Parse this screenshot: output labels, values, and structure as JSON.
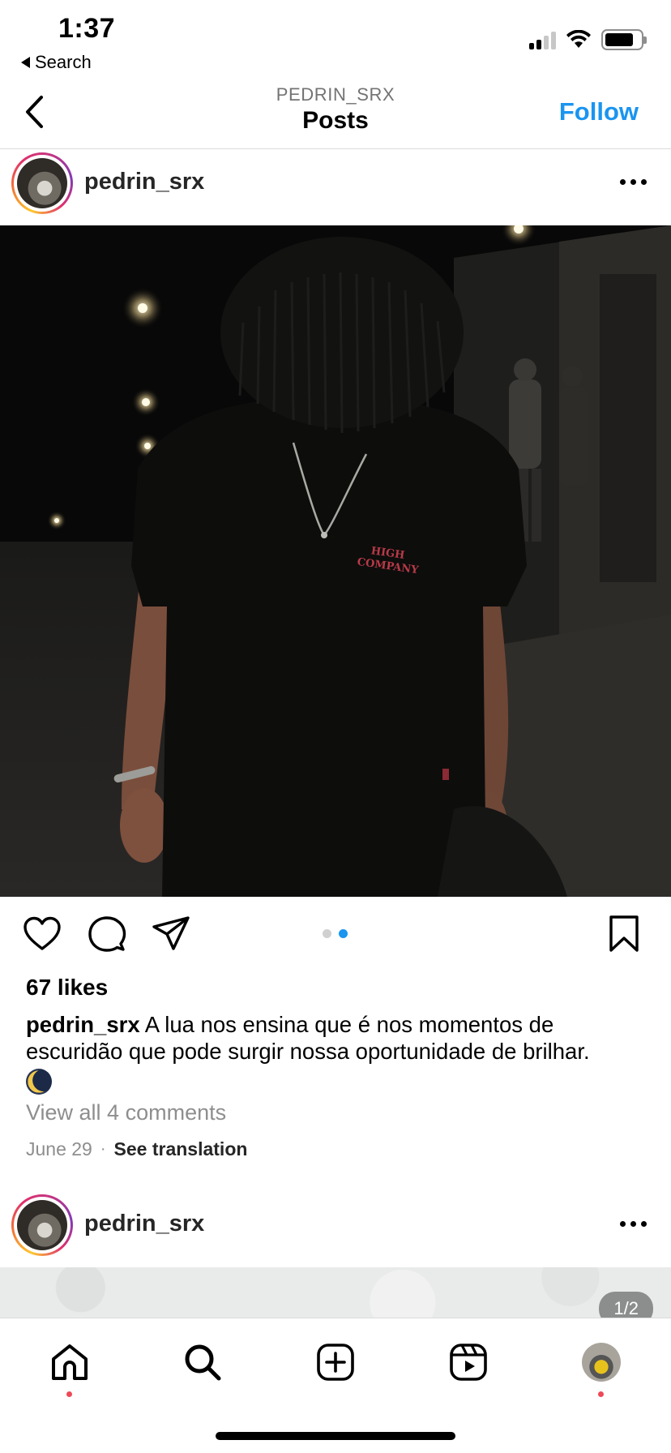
{
  "status_bar": {
    "time": "1:37",
    "back_label": "Search"
  },
  "header": {
    "subtitle": "PEDRIN_SRX",
    "title": "Posts",
    "follow_label": "Follow"
  },
  "post": {
    "username": "pedrin_srx",
    "shirt_text_line1": "HIGH",
    "shirt_text_line2": "COMPANY",
    "carousel": {
      "total": 2,
      "active": 2
    },
    "likes": "67 likes",
    "caption_user": "pedrin_srx",
    "caption_text": " A lua nos ensina que é nos momentos de escuridão que pode surgir nossa oportunidade de brilhar.",
    "caption_emoji": "moon-icon",
    "view_comments": "View all 4 comments",
    "date": "June 29",
    "date_separator": "·",
    "see_translation": "See translation"
  },
  "next_post": {
    "username": "pedrin_srx",
    "counter": "1/2"
  },
  "tabbar": {
    "items": [
      "home-icon",
      "search-icon",
      "new-post-icon",
      "reels-icon",
      "profile-avatar"
    ],
    "notification_dots": [
      "home",
      "profile"
    ]
  },
  "colors": {
    "accent": "#1a95f0",
    "notification": "#ed4956",
    "muted_text": "#8e8e8e",
    "photo_bg": "#0b0b0a"
  }
}
